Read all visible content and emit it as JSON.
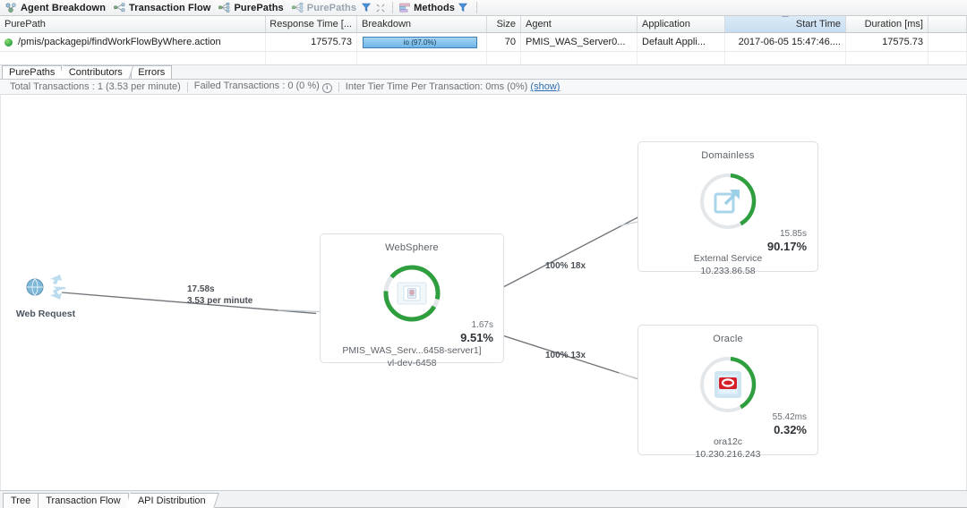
{
  "toolbar": {
    "items": [
      {
        "label": "Agent Breakdown",
        "icon": "agent-breakdown-icon",
        "dim": false
      },
      {
        "label": "Transaction Flow",
        "icon": "transaction-flow-icon",
        "dim": false
      },
      {
        "label": "PurePaths",
        "icon": "purepaths-icon",
        "dim": false
      },
      {
        "label": "PurePaths",
        "icon": "purepaths-icon",
        "dim": true
      }
    ],
    "filter_icon": "filter-funnel-icon",
    "expand_icon": "expand-icon",
    "methods": {
      "label": "Methods",
      "icon": "methods-icon"
    },
    "methods_filter_icon": "filter-funnel-icon"
  },
  "table": {
    "columns": [
      {
        "key": "purepath",
        "label": "PurePath",
        "align": "left"
      },
      {
        "key": "response_time",
        "label": "Response Time [...",
        "align": "right"
      },
      {
        "key": "breakdown",
        "label": "Breakdown",
        "align": "left"
      },
      {
        "key": "size",
        "label": "Size",
        "align": "right"
      },
      {
        "key": "agent",
        "label": "Agent",
        "align": "left"
      },
      {
        "key": "application",
        "label": "Application",
        "align": "left"
      },
      {
        "key": "start_time",
        "label": "Start Time",
        "align": "right",
        "sorted": true
      },
      {
        "key": "duration",
        "label": "Duration [ms]",
        "align": "right"
      }
    ],
    "rows": [
      {
        "purepath": "/pmis/packagepi/findWorkFlowByWhere.action",
        "response_time": "17575.73",
        "breakdown_label": "io (97.0%)",
        "breakdown_pct": 97,
        "size": "70",
        "agent": "PMIS_WAS_Server0...",
        "application": "Default Appli...",
        "start_time": "2017-06-05 15:47:46....",
        "duration": "17575.73",
        "status": "ok"
      }
    ]
  },
  "mid_tabs": [
    {
      "label": "PurePaths",
      "active": true
    },
    {
      "label": "Contributors",
      "active": false
    },
    {
      "label": "Errors",
      "active": false
    }
  ],
  "status_bar": {
    "total_transactions": "Total Transactions :  1 (3.53 per minute)",
    "failed_transactions": "Failed Transactions :  0 (0 %)",
    "inter_tier": "Inter Tier Time Per Transaction: 0ms (0%)",
    "show_link": "(show)"
  },
  "flow": {
    "source": {
      "label": "Web Request",
      "icon": "web-request-globe-icon"
    },
    "nodes": [
      {
        "id": "websphere",
        "title": "WebSphere",
        "icon": "websphere-server-icon",
        "time": "1.67s",
        "percent": "9.51%",
        "percent_value": 9.51,
        "arc_pct": 92,
        "sub_line1": "PMIS_WAS_Serv...6458-server1]",
        "sub_line2": "vl-dev-6458"
      },
      {
        "id": "domainless",
        "title": "Domainless",
        "icon": "external-service-icon",
        "time": "15.85s",
        "percent": "90.17%",
        "percent_value": 90.17,
        "arc_pct": 40,
        "sub_line1": "External Service",
        "sub_line2": "10.233.86.58"
      },
      {
        "id": "oracle",
        "title": "Oracle",
        "icon": "oracle-database-icon",
        "time": "55.42ms",
        "percent": "0.32%",
        "percent_value": 0.32,
        "arc_pct": 40,
        "sub_line1": "ora12c",
        "sub_line2": "10.230.216.243"
      }
    ],
    "edges": [
      {
        "id": "web-to-websphere",
        "line1": "17.58s",
        "line2": "3.53 per minute"
      },
      {
        "id": "websphere-to-domainless",
        "line1": "100% 18x",
        "line2": ""
      },
      {
        "id": "websphere-to-oracle",
        "line1": "100% 13x",
        "line2": ""
      }
    ]
  },
  "bottom_tabs": [
    {
      "label": "Tree",
      "active": false
    },
    {
      "label": "Transaction Flow",
      "active": false
    },
    {
      "label": "API Distribution",
      "active": true
    }
  ],
  "colors": {
    "accent_green": "#2e9e3e",
    "accent_blue": "#4a90d9",
    "oracle_red": "#d62027",
    "link_blue": "#2b6cb0"
  }
}
